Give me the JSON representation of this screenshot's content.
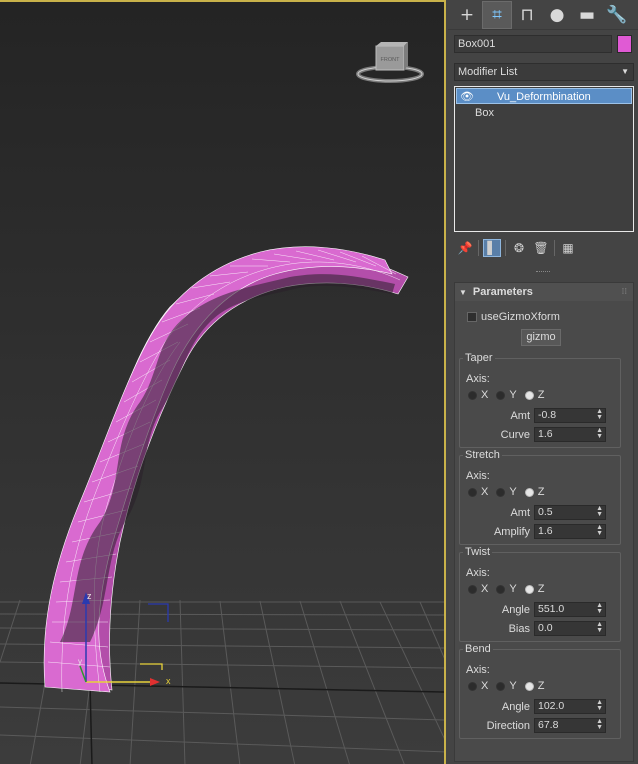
{
  "viewport": {
    "gizmo_axis_labels": {
      "x": "x",
      "z": "z",
      "y": "y"
    },
    "viewcube_label": "FRONT"
  },
  "panel": {
    "tabs": [
      {
        "icon": "create-icon",
        "glyph": "+"
      },
      {
        "icon": "modify-icon",
        "glyph": "⌗"
      },
      {
        "icon": "hierarchy-icon",
        "glyph": "⊓"
      },
      {
        "icon": "motion-icon",
        "glyph": "●"
      },
      {
        "icon": "display-icon",
        "glyph": "▬"
      },
      {
        "icon": "utilities-icon",
        "glyph": "🔧"
      }
    ],
    "object_name": "Box001",
    "object_color": "#e05ad4",
    "modifier_list_label": "Modifier List",
    "stack": [
      {
        "label": "Vu_Deformbination",
        "selected": true
      },
      {
        "label": "Box",
        "selected": false
      }
    ],
    "stack_tools": [
      "pin-stack-icon",
      "show-end-result-icon",
      "make-unique-icon",
      "remove-modifier-icon",
      "configure-modifier-sets-icon"
    ],
    "rollout": {
      "title": "Parameters",
      "use_gizmo_label": "useGizmoXform",
      "use_gizmo_checked": false,
      "gizmo_button": "gizmo",
      "axis_label": "Axis:",
      "axis_x": "X",
      "axis_y": "Y",
      "axis_z": "Z",
      "taper": {
        "title": "Taper",
        "axis": "Z",
        "amt_label": "Amt",
        "amt": "-0.8",
        "curve_label": "Curve",
        "curve": "1.6"
      },
      "stretch": {
        "title": "Stretch",
        "axis": "Z",
        "amt_label": "Amt",
        "amt": "0.5",
        "amplify_label": "Amplify",
        "amplify": "1.6"
      },
      "twist": {
        "title": "Twist",
        "axis": "Z",
        "angle_label": "Angle",
        "angle": "551.0",
        "bias_label": "Bias",
        "bias": "0.0"
      },
      "bend": {
        "title": "Bend",
        "axis": "Z",
        "angle_label": "Angle",
        "angle": "102.0",
        "direction_label": "Direction",
        "direction": "67.8"
      }
    }
  }
}
